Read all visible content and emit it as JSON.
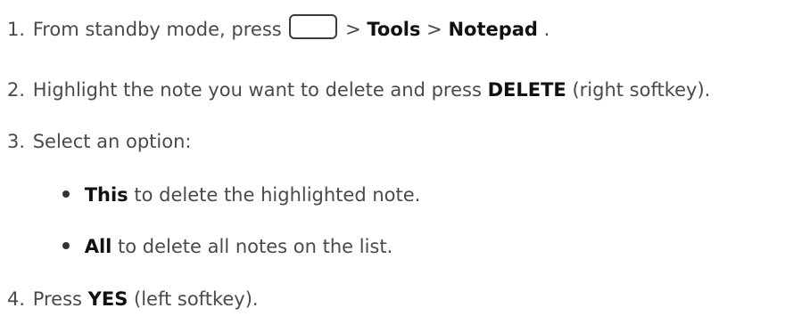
{
  "steps": [
    {
      "number": "1.",
      "text_before": "From standby mode, press",
      "icon": "menu-key-icon",
      "sep1": " > ",
      "bold1": "Tools",
      "sep2": " > ",
      "bold2": "Notepad",
      "end": "."
    },
    {
      "number": "2.",
      "text_before": "Highlight the note you want to delete and press ",
      "bold": "DELETE",
      "text_after": " (right softkey)."
    },
    {
      "number": "3.",
      "text": "Select an option:"
    },
    {
      "number": "4.",
      "text_before": "Press ",
      "bold": "YES",
      "text_after": " (left softkey)."
    }
  ],
  "options": [
    {
      "bold": "This",
      "text": " to delete the highlighted note."
    },
    {
      "bold": "All",
      "text": " to delete all notes on the list."
    }
  ]
}
